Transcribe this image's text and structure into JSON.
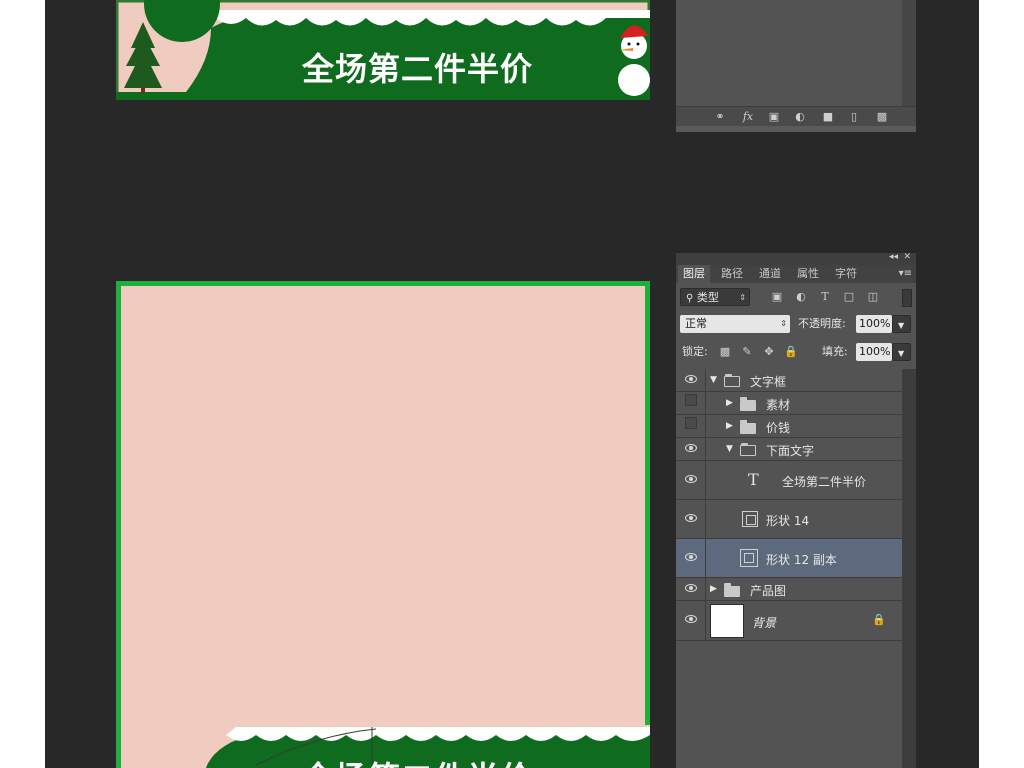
{
  "canvas": {
    "banner_text": "全场第二件半价",
    "bottom_banner_text": "全场第二件半价"
  },
  "colors": {
    "workspace": "#282828",
    "panel": "#535353",
    "selected_layer": "#5d6a7d",
    "canvas_pink": "#f0cbc0",
    "canvas_border": "#1db03d",
    "banner_green": "#2e7a2e"
  },
  "top_panel": {
    "icons": [
      "link-icon",
      "fx-icon",
      "mask-icon",
      "adjustment-icon",
      "folder-icon",
      "new-layer-icon",
      "trash-icon"
    ]
  },
  "layers_panel": {
    "tabs": [
      {
        "label": "图层",
        "active": true
      },
      {
        "label": "路径",
        "active": false
      },
      {
        "label": "通道",
        "active": false
      },
      {
        "label": "属性",
        "active": false
      },
      {
        "label": "字符",
        "active": false
      }
    ],
    "filter": {
      "value": "类型"
    },
    "blend_mode": {
      "value": "正常"
    },
    "opacity": {
      "label": "不透明度:",
      "value": "100%"
    },
    "lock": {
      "label": "锁定:"
    },
    "fill": {
      "label": "填充:",
      "value": "100%"
    },
    "layers": [
      {
        "name": "文字框",
        "kind": "folder",
        "expanded": true,
        "visible": true,
        "indent": 0,
        "selected": false
      },
      {
        "name": "素材",
        "kind": "folder",
        "expanded": false,
        "visible": false,
        "indent": 1,
        "selected": false
      },
      {
        "name": "价钱",
        "kind": "folder",
        "expanded": false,
        "visible": false,
        "indent": 1,
        "selected": false
      },
      {
        "name": "下面文字",
        "kind": "folder",
        "expanded": true,
        "visible": true,
        "indent": 1,
        "selected": false
      },
      {
        "name": "全场第二件半价",
        "kind": "text",
        "visible": true,
        "indent": 2,
        "selected": false
      },
      {
        "name": "形状 14",
        "kind": "shape",
        "visible": true,
        "indent": 2,
        "selected": false
      },
      {
        "name": "形状 12 副本",
        "kind": "shape",
        "visible": true,
        "indent": 2,
        "selected": true
      },
      {
        "name": "产品图",
        "kind": "folder",
        "expanded": false,
        "visible": true,
        "indent": 0,
        "selected": false
      },
      {
        "name": "背景",
        "kind": "background",
        "visible": true,
        "indent": 0,
        "selected": false,
        "locked": true
      }
    ]
  }
}
